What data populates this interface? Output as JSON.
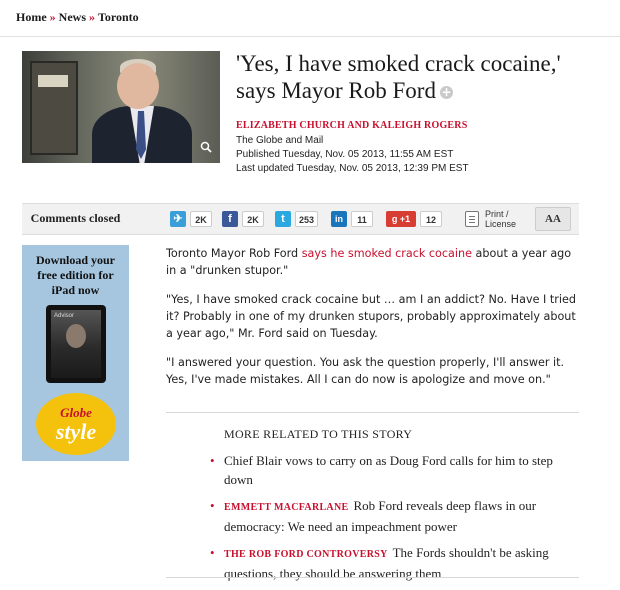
{
  "breadcrumb": {
    "items": [
      "Home",
      "News",
      "Toronto"
    ],
    "separator": "»"
  },
  "hero": {
    "zoom_icon": "magnifier-icon"
  },
  "headline": {
    "title": "'Yes, I have smoked crack cocaine,' says Mayor Rob Ford",
    "plus_symbol": "+"
  },
  "byline": {
    "authors": "ELIZABETH CHURCH AND KALEIGH ROGERS",
    "publication": "The Globe and Mail",
    "published": "Published Tuesday, Nov. 05 2013, 11:55 AM EST",
    "updated": "Last updated Tuesday, Nov. 05 2013, 12:39 PM EST"
  },
  "toolbar": {
    "comments_label": "Comments closed",
    "shares": [
      {
        "name": "share-icon",
        "glyph": "✈",
        "color": "#3a9fd8",
        "count": "2K"
      },
      {
        "name": "facebook-icon",
        "glyph": "f",
        "color": "#3b5998",
        "count": "2K"
      },
      {
        "name": "twitter-icon",
        "glyph": "t",
        "color": "#2aa9e0",
        "count": "253"
      },
      {
        "name": "linkedin-icon",
        "glyph": "in",
        "color": "#1b75bb",
        "count": "11"
      },
      {
        "name": "google-plus-icon",
        "glyph": "g +1",
        "color": "#d73d32",
        "count": "12"
      }
    ],
    "print_line1": "Print /",
    "print_line2": "License",
    "text_size_label": "AA"
  },
  "ad": {
    "lines": [
      "Download your",
      "free edition for",
      "iPad now"
    ],
    "magazine_name": "Advisor",
    "badge_top": "Globe",
    "badge_bottom": "style"
  },
  "article": {
    "p1_before": "Toronto Mayor Rob Ford ",
    "p1_link": "says he smoked crack cocaine",
    "p1_after": " about a year ago in a \"drunken stupor.\"",
    "p2": "\"Yes, I have smoked crack cocaine but … am I an addict? No. Have I tried it? Probably in one of my drunken stupors, probably approximately about a year ago,\" Mr. Ford said on Tuesday.",
    "p3": "\"I answered your question. You ask the question properly, I'll answer it. Yes, I've made mistakes. All I can do now is apologize and move on.\""
  },
  "related": {
    "title": "MORE RELATED TO THIS STORY",
    "items": [
      {
        "tag": "",
        "text": "Chief Blair vows to carry on as Doug Ford calls for him to step down"
      },
      {
        "tag": "EMMETT MACFARLANE",
        "text": "Rob Ford reveals deep flaws in our democracy: We need an impeachment power"
      },
      {
        "tag": "THE ROB FORD CONTROVERSY",
        "text": "The Fords shouldn't be asking questions, they should be answering them"
      }
    ]
  }
}
